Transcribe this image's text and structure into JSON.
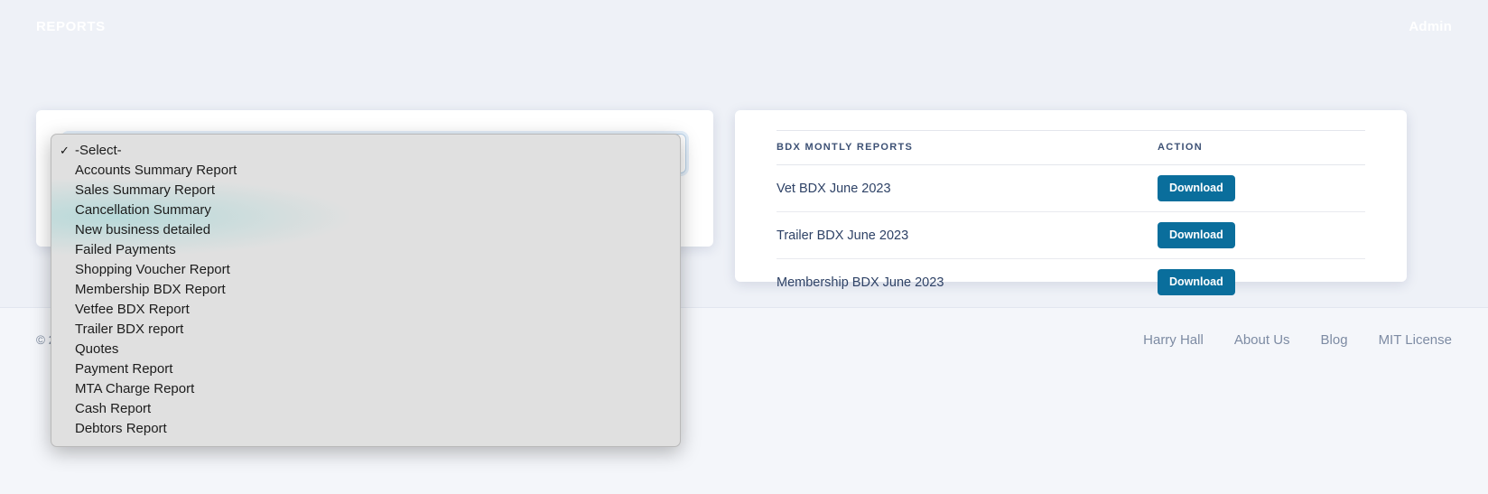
{
  "header": {
    "title": "REPORTS",
    "admin_label": "Admin",
    "gradient_from": "#006a9b",
    "gradient_to": "#062d8e"
  },
  "report_select": {
    "name": "report-type-select",
    "selected_value": "-Select-",
    "caret_icon": "chevron-down-icon",
    "options": [
      {
        "label": "-Select-",
        "selected": true
      },
      {
        "label": "Accounts Summary Report",
        "selected": false
      },
      {
        "label": "Sales Summary Report",
        "selected": false
      },
      {
        "label": "Cancellation Summary",
        "selected": false
      },
      {
        "label": "New business detailed",
        "selected": false
      },
      {
        "label": "Failed Payments",
        "selected": false
      },
      {
        "label": "Shopping Voucher Report",
        "selected": false
      },
      {
        "label": "Membership BDX Report",
        "selected": false
      },
      {
        "label": "Vetfee BDX Report",
        "selected": false
      },
      {
        "label": "Trailer BDX report",
        "selected": false
      },
      {
        "label": "Quotes",
        "selected": false
      },
      {
        "label": "Payment Report",
        "selected": false
      },
      {
        "label": "MTA Charge Report",
        "selected": false
      },
      {
        "label": "Cash Report",
        "selected": false
      },
      {
        "label": "Debtors Report",
        "selected": false
      }
    ],
    "check_glyph": "✓"
  },
  "bdx_panel": {
    "columns": [
      "BDX MONTLY REPORTS",
      "ACTION"
    ],
    "rows": [
      {
        "name": "Vet BDX June 2023",
        "action_label": "Download"
      },
      {
        "name": "Trailer BDX June 2023",
        "action_label": "Download"
      },
      {
        "name": "Membership BDX June 2023",
        "action_label": "Download"
      }
    ],
    "button_color": "#0a6e9c"
  },
  "footer": {
    "copyright": "© 2",
    "links": [
      {
        "label": "Harry Hall"
      },
      {
        "label": "About Us"
      },
      {
        "label": "Blog"
      },
      {
        "label": "MIT License"
      }
    ]
  }
}
